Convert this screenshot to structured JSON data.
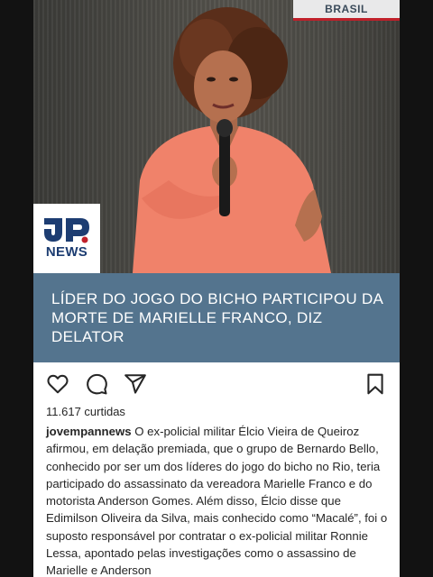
{
  "post": {
    "section_tag": "BRASIL",
    "logo": {
      "mark": "JP",
      "text": "NEWS"
    },
    "headline": "LÍDER DO JOGO DO BICHO PARTICIPOU DA MORTE DE MARIELLE FRANCO, DIZ DELATOR",
    "actions": {
      "like_icon": "heart-icon",
      "comment_icon": "comment-icon",
      "share_icon": "send-icon",
      "save_icon": "bookmark-icon"
    },
    "likes": "11.617 curtidas",
    "username": "jovempannews",
    "caption": "O ex-policial militar Élcio Vieira de Queiroz afirmou, em delação premiada, que o grupo de Bernardo Bello, conhecido por ser um dos líderes do jogo do bicho no Rio, teria participado do assassinato da vereadora Marielle Franco e do motorista Anderson Gomes. Além disso, Élcio disse que Edimilson Oliveira da Silva, mais conhecido como “Macalé”, foi o suposto responsável por contratar o ex-policial militar Ronnie Lessa, apontado pelas investigações como o assassino de Marielle e Anderson"
  },
  "colors": {
    "headline_band": "#54748e",
    "logo_blue": "#1d3d72",
    "tag_accent": "#c0202a",
    "shirt": "#f0826a"
  }
}
